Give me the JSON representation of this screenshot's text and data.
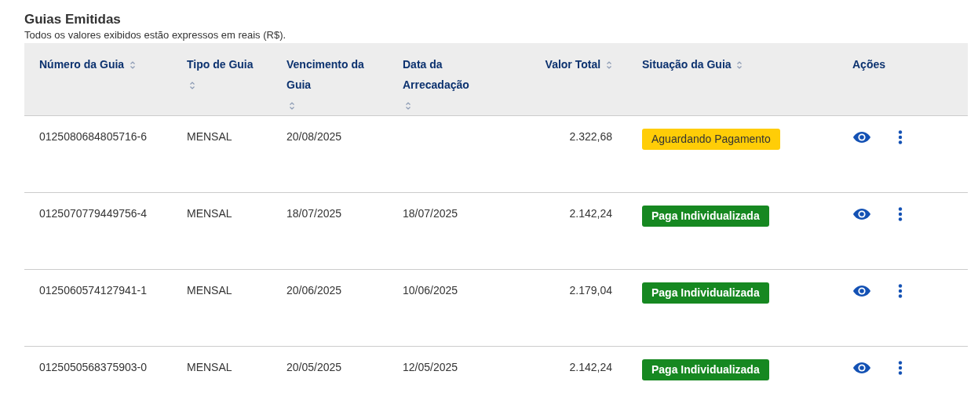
{
  "title": "Guias Emitidas",
  "subtitle": "Todos os valores exibidos estão expressos em reais (R$).",
  "table": {
    "columns": [
      {
        "label": "Número da Guia",
        "sortable": true
      },
      {
        "label": "Tipo de Guia",
        "sortable": true
      },
      {
        "label": "Vencimento da Guia",
        "sortable": true
      },
      {
        "label": "Data da Arrecadação",
        "sortable": true
      },
      {
        "label": "Valor Total",
        "sortable": true
      },
      {
        "label": "Situação da Guia",
        "sortable": true
      },
      {
        "label": "Ações",
        "sortable": false
      }
    ],
    "rows": [
      {
        "numero": "0125080684805716-6",
        "tipo": "MENSAL",
        "vencimento": "20/08/2025",
        "arrecadacao": "",
        "valor": "2.322,68",
        "situacao": {
          "label": "Aguardando Pagamento",
          "kind": "pending"
        }
      },
      {
        "numero": "0125070779449756-4",
        "tipo": "MENSAL",
        "vencimento": "18/07/2025",
        "arrecadacao": "18/07/2025",
        "valor": "2.142,24",
        "situacao": {
          "label": "Paga Individualizada",
          "kind": "paid"
        }
      },
      {
        "numero": "0125060574127941-1",
        "tipo": "MENSAL",
        "vencimento": "20/06/2025",
        "arrecadacao": "10/06/2025",
        "valor": "2.179,04",
        "situacao": {
          "label": "Paga Individualizada",
          "kind": "paid"
        }
      },
      {
        "numero": "0125050568375903-0",
        "tipo": "MENSAL",
        "vencimento": "20/05/2025",
        "arrecadacao": "12/05/2025",
        "valor": "2.142,24",
        "situacao": {
          "label": "Paga Individualizada",
          "kind": "paid"
        }
      }
    ]
  }
}
